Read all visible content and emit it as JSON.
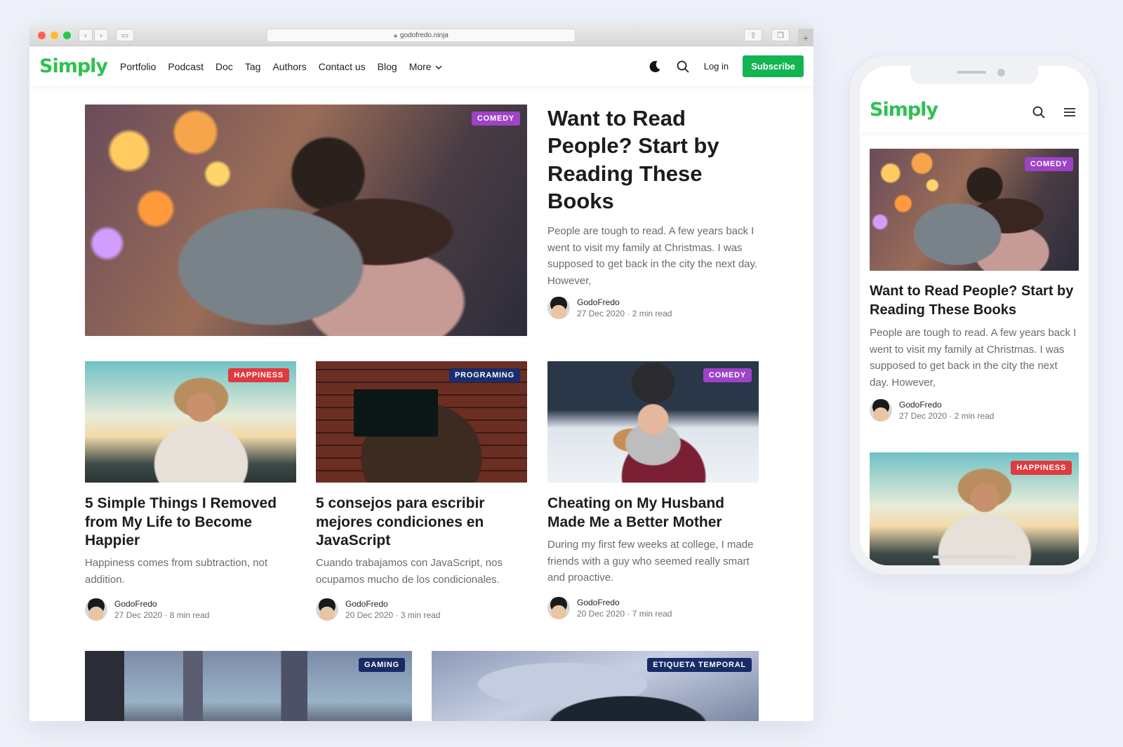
{
  "browser": {
    "url": "godofredo.ninja"
  },
  "site": {
    "logo": "Simply",
    "nav": [
      "Portfolio",
      "Podcast",
      "Doc",
      "Tag",
      "Authors",
      "Contact us",
      "Blog",
      "More"
    ],
    "login": "Log in",
    "subscribe": "Subscribe"
  },
  "featured": {
    "tag": "COMEDY",
    "title": "Want to Read People? Start by Reading These Books",
    "excerpt": "People are tough to read. A few years back I went to visit my family at Christmas. I was supposed to get back in the city the next day. However,",
    "author": "GodoFredo",
    "meta": "27 Dec 2020 · 2 min read"
  },
  "posts": [
    {
      "tag": "HAPPINESS",
      "title": "5 Simple Things I Removed from My Life to Become Happier",
      "excerpt": "Happiness comes from subtraction, not addition.",
      "author": "GodoFredo",
      "meta": "27 Dec 2020 · 8 min read"
    },
    {
      "tag": "PROGRAMING",
      "title": "5 consejos para escribir mejores condiciones en JavaScript",
      "excerpt": "Cuando trabajamos con JavaScript, nos ocupamos mucho de los condicionales.",
      "author": "GodoFredo",
      "meta": "20 Dec 2020 · 3 min read"
    },
    {
      "tag": "COMEDY",
      "title": "Cheating on My Husband Made Me a Better Mother",
      "excerpt": "During my first few weeks at college, I made friends with a guy who seemed really smart and proactive.",
      "author": "GodoFredo",
      "meta": "20 Dec 2020 · 7 min read"
    }
  ],
  "bottom_posts": [
    {
      "tag": "GAMING"
    },
    {
      "tag": "ETIQUETA TEMPORAL"
    }
  ],
  "mobile": {
    "logo": "Simply",
    "featured": {
      "tag": "COMEDY",
      "title": "Want to Read People? Start by Reading These Books",
      "excerpt": "People are tough to read. A few years back I went to visit my family at Christmas. I was supposed to get back in the city the next day. However,",
      "author": "GodoFredo",
      "meta": "27 Dec 2020 · 2 min read"
    },
    "next_tag": "HAPPINESS"
  },
  "colors": {
    "brand_green": "#2ec150",
    "subscribe_green": "#13b552",
    "tag_comedy": "#9e42c8",
    "tag_happiness": "#e03a3e",
    "tag_programing": "#1a2d6e"
  },
  "icons": [
    "moon-icon",
    "search-icon",
    "chevron-down-icon",
    "menu-icon",
    "lock-icon"
  ]
}
